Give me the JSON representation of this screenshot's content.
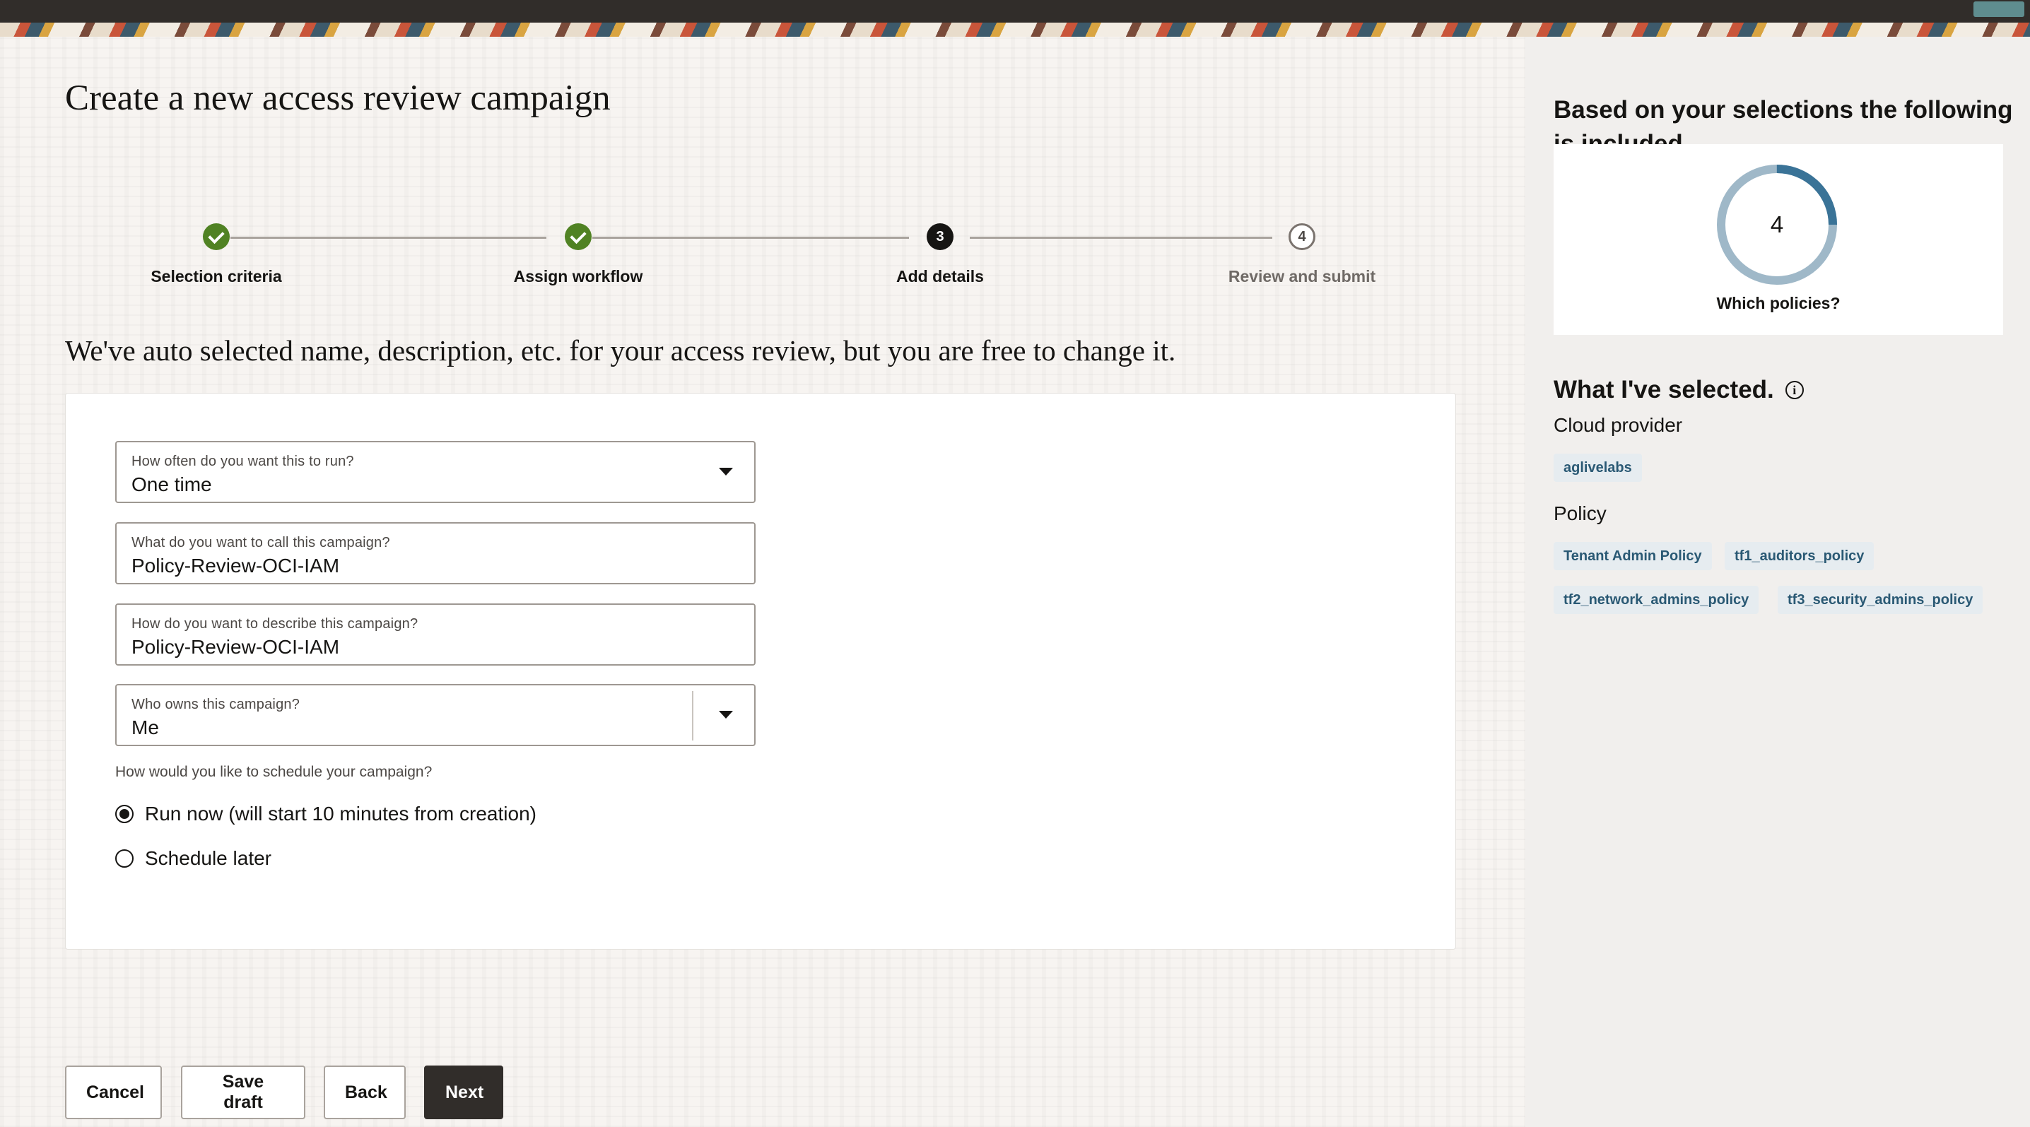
{
  "page": {
    "title": "Create a new access review campaign",
    "subtitle": "We've auto selected name, description, etc. for your access review, but you are free to change it."
  },
  "stepper": {
    "steps": [
      {
        "number": "1",
        "label": "Selection criteria",
        "state": "completed"
      },
      {
        "number": "2",
        "label": "Assign workflow",
        "state": "completed"
      },
      {
        "number": "3",
        "label": "Add details",
        "state": "current"
      },
      {
        "number": "4",
        "label": "Review and submit",
        "state": "upcoming"
      }
    ],
    "completed_icon": "check-icon",
    "colors": {
      "completed": "#508223",
      "current": "#161513"
    }
  },
  "form": {
    "frequency": {
      "label": "How often do you want this to run?",
      "value": "One time"
    },
    "name": {
      "label": "What do you want to call this campaign?",
      "value": "Policy-Review-OCI-IAM"
    },
    "description": {
      "label": "How do you want to describe this campaign?",
      "value": "Policy-Review-OCI-IAM"
    },
    "owner": {
      "label": "Who owns this campaign?",
      "value": "Me"
    },
    "schedule": {
      "question": "How would you like to schedule your campaign?",
      "options": [
        {
          "label": "Run now (will start 10 minutes from creation)",
          "selected": true
        },
        {
          "label": "Schedule later",
          "selected": false
        }
      ]
    }
  },
  "buttons": {
    "cancel": "Cancel",
    "save_draft": "Save draft",
    "back": "Back",
    "next": "Next"
  },
  "sidebar": {
    "title": "Based on your selections the following is included.",
    "summary": {
      "count": "4",
      "caption": "Which policies?",
      "ring_colors": {
        "track": "#9fb8c8",
        "accent": "#3a7397"
      }
    },
    "selected_title": "What I've selected.",
    "info_icon": "info-icon",
    "cloud_provider": {
      "label": "Cloud provider",
      "chips": [
        "aglivelabs"
      ]
    },
    "policy": {
      "label": "Policy",
      "chips": [
        "Tenant Admin Policy",
        "tf1_auditors_policy",
        "tf2_network_admins_policy",
        "tf3_security_admins_policy"
      ]
    }
  }
}
